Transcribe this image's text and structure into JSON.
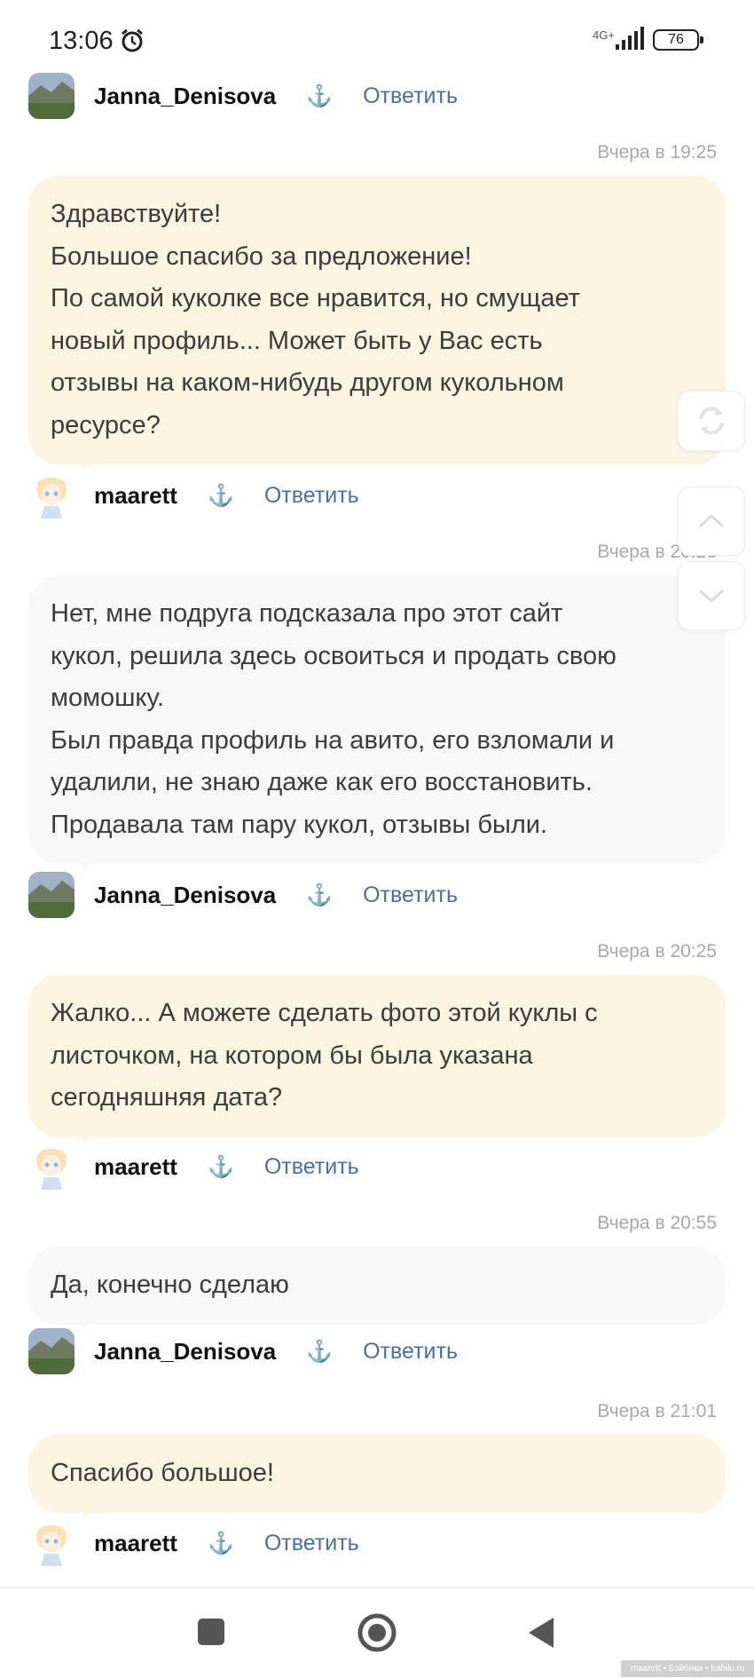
{
  "status_bar": {
    "time": "13:06",
    "network": "4G+",
    "battery": "76"
  },
  "users": {
    "janna": "Janna_Denisova",
    "maarett": "maarett"
  },
  "actions": {
    "reply": "Ответить"
  },
  "messages": [
    {
      "time": "Вчера в 19:25",
      "lines": [
        "Здравствуйте!",
        "Большое спасибо за предложение!",
        "По самой куколке все нравится, но смущает",
        "новый профиль... Может быть у Вас есть",
        "отзывы на каком-нибудь другом кукольном",
        "ресурсе?"
      ],
      "author": "maarett"
    },
    {
      "time": "Вчера в 20:23",
      "lines": [
        "Нет, мне подруга подсказала про этот сайт",
        "кукол, решила здесь освоиться и продать свою",
        "момошку.",
        "Был правда профиль на авито, его взломали и",
        "удалили, не знаю даже как его восстановить.",
        "Продавала там пару кукол, отзывы были."
      ],
      "author": "Janna_Denisova"
    },
    {
      "time": "Вчера в 20:25",
      "lines": [
        "Жалко... А можете сделать фото этой куклы с",
        "листочком, на котором бы была указана",
        "сегодняшняя дата?"
      ],
      "author": "maarett"
    },
    {
      "time": "Вчера в 20:55",
      "lines": [
        "Да, конечно сделаю"
      ],
      "author": "Janna_Denisova"
    },
    {
      "time": "Вчера в 21:01",
      "lines": [
        "Спасибо большое!"
      ],
      "author": "maarett"
    }
  ],
  "watermark": "maarett • Бэйбики • babiki.ru",
  "icons": {
    "alarm": "alarm-icon",
    "anchor": "anchor-icon",
    "refresh": "refresh-icon",
    "scroll_up": "chevron-up-icon",
    "scroll_down": "chevron-down-icon",
    "recent": "square-icon",
    "home": "circle-icon",
    "back": "triangle-back-icon"
  },
  "colors": {
    "bubble_yellow": "#fdf4e2",
    "bubble_grey": "#f8f8f8",
    "link": "#4a6fa5",
    "timestamp": "#a8a8a8"
  }
}
